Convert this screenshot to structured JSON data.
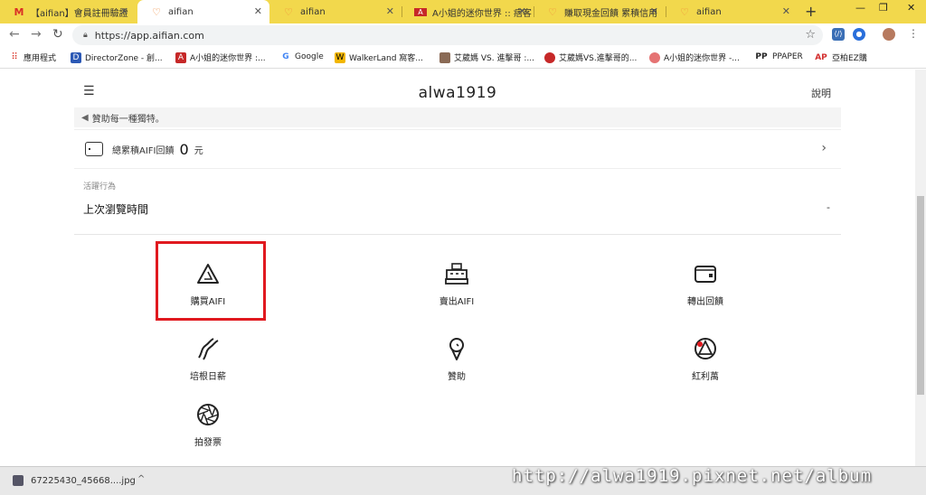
{
  "browser": {
    "tabs": [
      {
        "label": "【aifian】會員註冊驗證",
        "icon": "gmail-icon"
      },
      {
        "label": "aifian",
        "icon": "aifian-icon"
      },
      {
        "label": "aifian",
        "icon": "aifian-icon"
      },
      {
        "label": "A小姐的迷你世界 :: 痞客",
        "icon": "pixnet-icon"
      },
      {
        "label": "賺取現金回饋 累積信用",
        "icon": "aifian-icon"
      },
      {
        "label": "aifian",
        "icon": "aifian-icon"
      }
    ],
    "url": "https://app.aifian.com",
    "bookmarks": [
      {
        "label": "應用程式",
        "icon": "apps-grid-icon"
      },
      {
        "label": "DirectorZone - 創...",
        "icon": "directorzone-icon"
      },
      {
        "label": "A小姐的迷你世界 :...",
        "icon": "pixnet-icon"
      },
      {
        "label": "Google",
        "icon": "google-icon"
      },
      {
        "label": "WalkerLand 窩客...",
        "icon": "walkerland-icon"
      },
      {
        "label": "艾葳媽 VS. 進擊哥 :...",
        "icon": "blog-icon"
      },
      {
        "label": "艾葳媽VS.進擊哥的...",
        "icon": "blog-icon"
      },
      {
        "label": "A小姐的迷你世界 -...",
        "icon": "blog-icon"
      },
      {
        "label": "PPAPER",
        "icon": "ppaper-icon"
      },
      {
        "label": "亞柏EZ購",
        "icon": "ap-icon"
      }
    ]
  },
  "app": {
    "title": "alwa1919",
    "help": "說明",
    "notice": "贊助每一種獨特。",
    "reward_label": "總累積AIFI回饋",
    "reward_value": "0",
    "reward_unit": "元",
    "activity_heading": "活躍行為",
    "last_visit_label": "上次瀏覽時間",
    "last_visit_value": "-",
    "actions": [
      {
        "label": "購買AIFI",
        "icon": "aifi-triangle-icon"
      },
      {
        "label": "賣出AIFI",
        "icon": "cash-register-icon"
      },
      {
        "label": "轉出回饋",
        "icon": "wallet-icon"
      },
      {
        "label": "培根日薪",
        "icon": "bacon-icon"
      },
      {
        "label": "贊助",
        "icon": "ice-cream-icon"
      },
      {
        "label": "紅利萬",
        "icon": "bonus-wheel-icon"
      },
      {
        "label": "拍發票",
        "icon": "camera-shutter-icon"
      }
    ]
  },
  "download": {
    "filename": "67225430_45668....jpg"
  },
  "watermark": "http://alwa1919.pixnet.net/album",
  "colors": {
    "tabbar": "#f2d84c",
    "highlight": "#e0191f"
  }
}
